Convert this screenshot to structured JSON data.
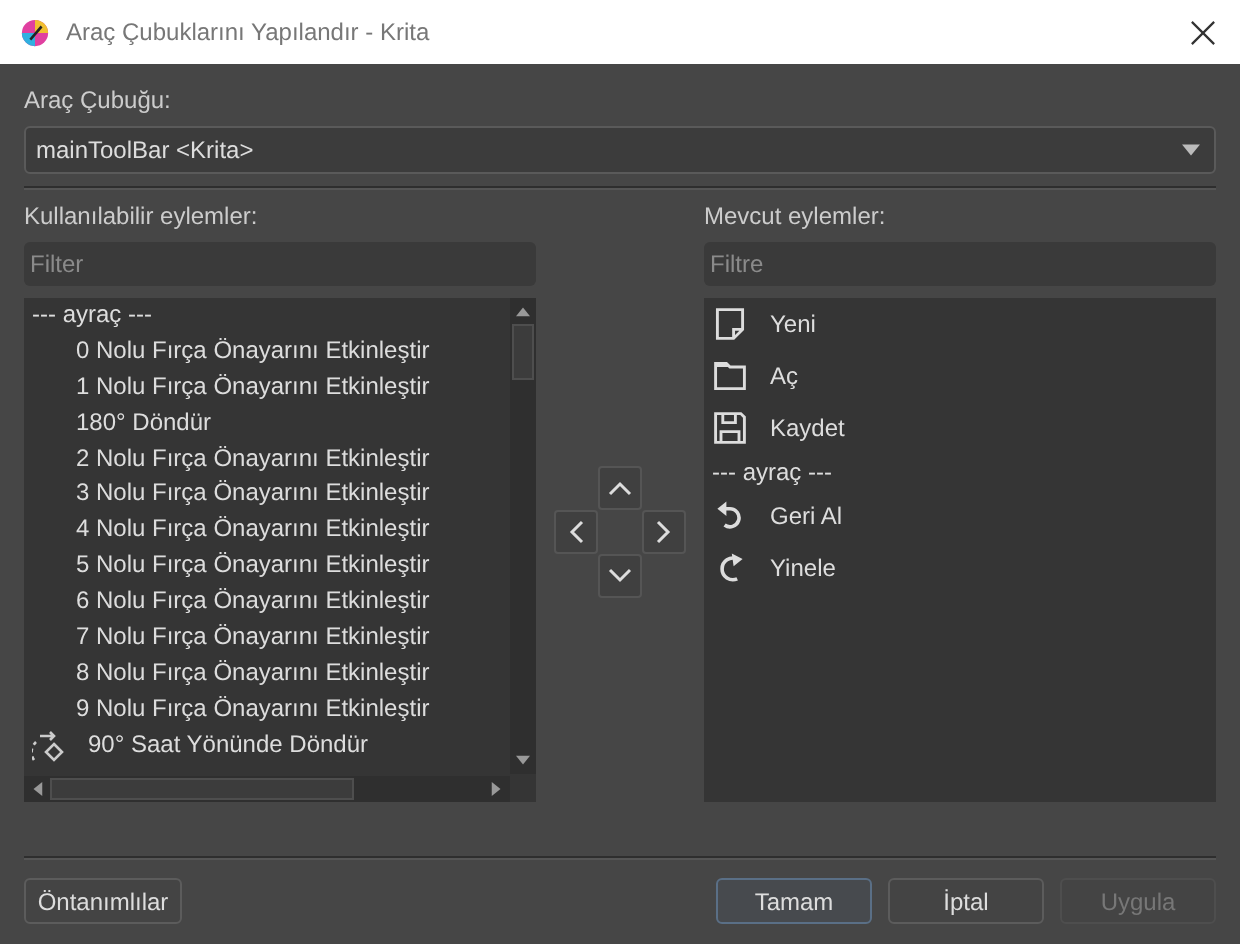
{
  "window": {
    "title": "Araç Çubuklarını Yapılandır - Krita"
  },
  "toolbar_label": "Araç Çubuğu:",
  "toolbar_select": {
    "value": "mainToolBar <Krita>"
  },
  "available": {
    "label": "Kullanılabilir eylemler:",
    "filter": {
      "placeholder": "Filter"
    },
    "items": [
      {
        "kind": "separator",
        "text": "--- ayraç ---"
      },
      {
        "kind": "plain",
        "text": "0 Nolu Fırça Önayarını Etkinleştir"
      },
      {
        "kind": "plain",
        "text": "1 Nolu Fırça Önayarını Etkinleştir"
      },
      {
        "kind": "plain",
        "text": "180° Döndür"
      },
      {
        "kind": "plain",
        "text": "2 Nolu Fırça Önayarını Etkinleştir"
      },
      {
        "kind": "plain",
        "text": "3 Nolu Fırça Önayarını Etkinleştir"
      },
      {
        "kind": "plain",
        "text": "4 Nolu Fırça Önayarını Etkinleştir"
      },
      {
        "kind": "plain",
        "text": "5 Nolu Fırça Önayarını Etkinleştir"
      },
      {
        "kind": "plain",
        "text": "6 Nolu Fırça Önayarını Etkinleştir"
      },
      {
        "kind": "plain",
        "text": "7 Nolu Fırça Önayarını Etkinleştir"
      },
      {
        "kind": "plain",
        "text": "8 Nolu Fırça Önayarını Etkinleştir"
      },
      {
        "kind": "plain",
        "text": "9 Nolu Fırça Önayarını Etkinleştir"
      },
      {
        "kind": "rotate",
        "text": "90° Saat Yönünde Döndür"
      }
    ]
  },
  "current": {
    "label": "Mevcut eylemler:",
    "filter": {
      "placeholder": "Filtre"
    },
    "items": [
      {
        "kind": "document",
        "text": "Yeni"
      },
      {
        "kind": "folder",
        "text": "Aç"
      },
      {
        "kind": "save",
        "text": "Kaydet"
      },
      {
        "kind": "separator",
        "text": "--- ayraç ---"
      },
      {
        "kind": "undo",
        "text": "Geri Al"
      },
      {
        "kind": "redo",
        "text": "Yinele"
      }
    ]
  },
  "buttons": [
    {
      "label": "Öntanımlılar",
      "focused": false,
      "disabled": false
    },
    {
      "label": "Tamam",
      "focused": true,
      "disabled": false
    },
    {
      "label": "İptal",
      "focused": false,
      "disabled": false
    },
    {
      "label": "Uygula",
      "focused": false,
      "disabled": true
    }
  ]
}
